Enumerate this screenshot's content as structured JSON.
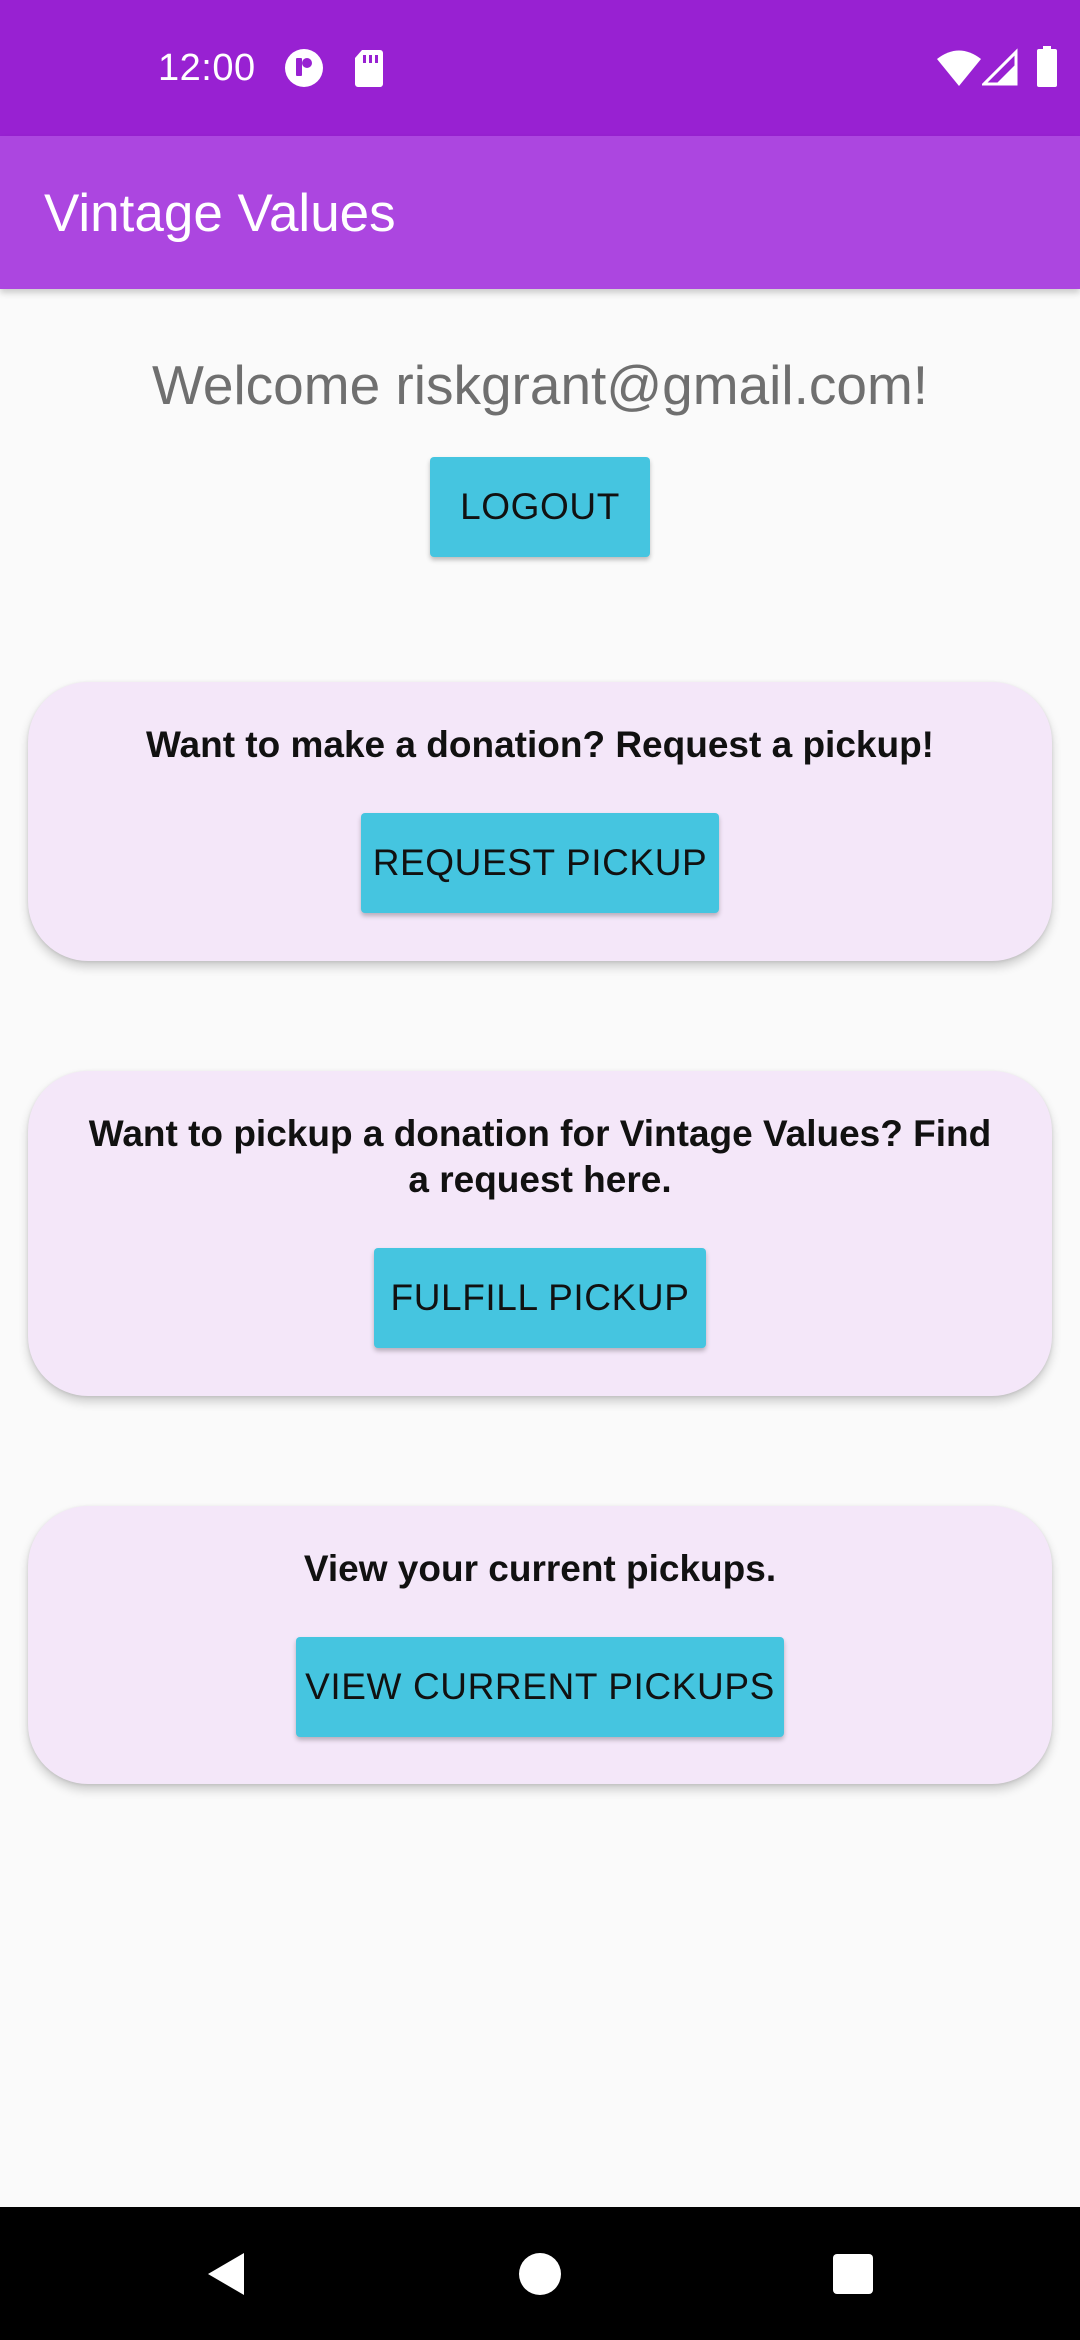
{
  "status_bar": {
    "time": "12:00",
    "icons_left": [
      "notification-icon",
      "sd-card-icon"
    ],
    "icons_right": [
      "wifi-icon",
      "signal-icon",
      "battery-icon"
    ]
  },
  "app_bar": {
    "title": "Vintage Values"
  },
  "welcome": {
    "text": "Welcome riskgrant@gmail.com!",
    "logout_label": "LOGOUT"
  },
  "cards": [
    {
      "text": "Want to make a donation? Request a pickup!",
      "button_label": "REQUEST PICKUP"
    },
    {
      "text": "Want to pickup a donation for Vintage Values? Find a request here.",
      "button_label": "FULFILL PICKUP"
    },
    {
      "text": "View your current pickups.",
      "button_label": "VIEW CURRENT PICKUPS"
    }
  ],
  "nav_bar": {
    "icons": [
      "back-icon",
      "home-icon",
      "recents-icon"
    ]
  },
  "colors": {
    "status_bar": "#9821d2",
    "app_bar": "#ac46e0",
    "card_background": "#f4e7f9",
    "button": "#45c5e0",
    "background": "#fafafa"
  }
}
